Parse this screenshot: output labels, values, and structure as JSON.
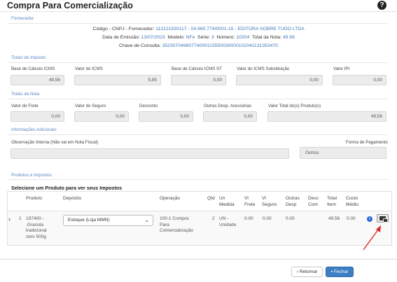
{
  "header": {
    "title": "Compra Para Comercialização",
    "help_icon": "question-circle-icon"
  },
  "sections": {
    "fornecedor": "Fornecedor",
    "totais_imposto": "Totais de Imposto",
    "totais_nota": "Totais da Nota",
    "info_adicionais": "Informações Adicionais",
    "produtos_impostos": "Produtos e Impostos"
  },
  "fornecedor": {
    "codigo_label": "Código - CNPJ - Fornecedor:",
    "codigo_value": "112121530117 - 04.960.774/0001-15 - EDITORA SOBRE TUDO LTDA",
    "data_label": "Data de Emissão:",
    "data_value": "13/07/2023",
    "modelo_label": "Modelo:",
    "modelo_value": "NFe",
    "serie_label": "Série:",
    "serie_value": "3",
    "numero_label": "Número:",
    "numero_value": "10204",
    "total_label": "Total da Nota:",
    "total_value": "49.56",
    "chave_label": "Chave de Consulta:",
    "chave_value": "35230704960774000115550030000102041131353470"
  },
  "totais_imposto": [
    {
      "label": "Base de Cálculo ICMS",
      "value": "49,56"
    },
    {
      "label": "Valor do ICMS",
      "value": "5,95"
    },
    {
      "label": "Base de Cálculo ICMS ST",
      "value": "0,00"
    },
    {
      "label": "Valor do ICMS Substituição",
      "value": "0,00"
    },
    {
      "label": "Valor IPI",
      "value": "0,00"
    }
  ],
  "totais_nota": [
    {
      "label": "Valor do Frete",
      "value": "0,00"
    },
    {
      "label": "Valor do Seguro",
      "value": "0,00"
    },
    {
      "label": "Desconto",
      "value": "0,00"
    },
    {
      "label": "Outras Desp. Acessórias",
      "value": "0,00"
    },
    {
      "label": "Valor Total do(s) Produto(s)",
      "value": "49,56"
    }
  ],
  "info_adicionais": {
    "obs_label": "Observação Interna (Não vai em Nota Fiscal)",
    "obs_value": "",
    "pagamento_label": "Forma de Pagamento",
    "pagamento_value": "Outros"
  },
  "produtos": {
    "subtitle": "Selecione um Produto para ver seus Impostos",
    "columns": [
      "Produto",
      "Depósito",
      "Operação",
      "Qtd",
      "Un Medida",
      "Vl Frete",
      "Vl Seguro",
      "Outras Desp",
      "Desc Com",
      "Total Item",
      "Custo Médio"
    ],
    "row": {
      "index": "1",
      "produto": [
        "197400 -",
        ".Granola",
        "tradicional",
        "zero 500g"
      ],
      "deposito": "Estoque (Loja MMN)",
      "operacao": [
        "100-1 Compra",
        "Para",
        "Comercialização"
      ],
      "qtd": "2",
      "un_medida": [
        "UN -",
        "Unidade"
      ],
      "vl_frete": "0.00",
      "vl_seguro": "0.00",
      "outras_desp": "0.00",
      "desc_com": "",
      "total_item": "49.56",
      "custo_medio": "0.00"
    }
  },
  "footer": {
    "back_label": "Retornar",
    "close_label": "Fechar"
  },
  "colors": {
    "accent": "#3d7fc5",
    "section": "#5a86c5",
    "link_value": "#3f78b9",
    "arrow": "#d9252a"
  }
}
